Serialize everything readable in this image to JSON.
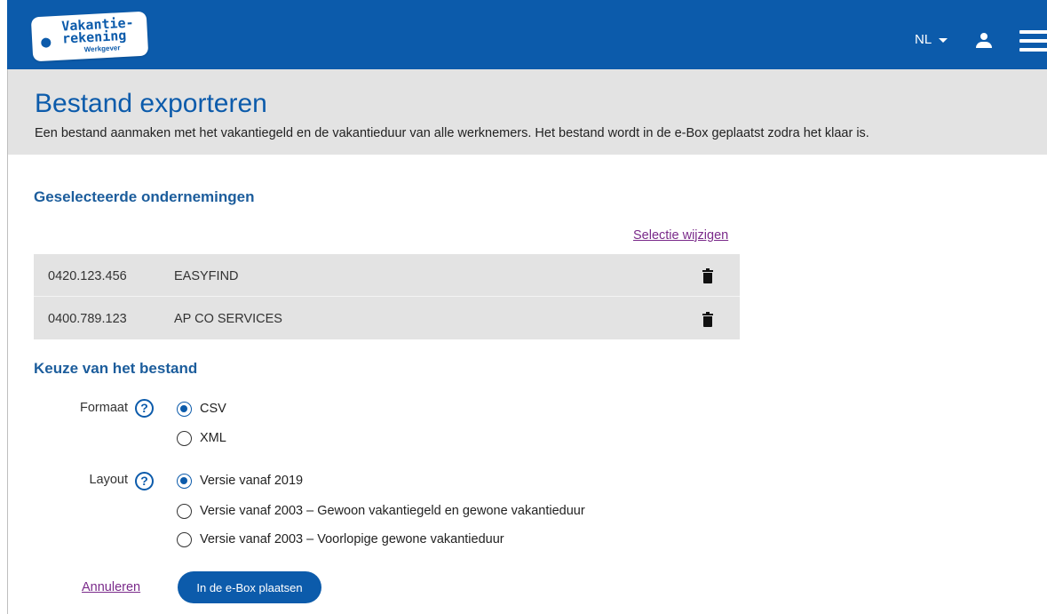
{
  "header": {
    "logo": {
      "line1": "Vakantie-",
      "line2": "rekening",
      "line3": "Werkgever"
    },
    "language": "NL",
    "icons": [
      "chevron-down-icon",
      "user-icon",
      "hamburger-menu-icon"
    ],
    "brand_color": "#0c5bab"
  },
  "page": {
    "title": "Bestand exporteren",
    "description": "Een bestand aanmaken met het vakantiegeld en de vakantieduur van alle werknemers. Het bestand wordt in de e-Box geplaatst zodra het klaar is."
  },
  "companies": {
    "heading": "Geselecteerde ondernemingen",
    "change_link": "Selectie wijzigen",
    "rows": [
      {
        "number": "0420.123.456",
        "name": "EASYFIND"
      },
      {
        "number": "0400.789.123",
        "name": "AP CO SERVICES"
      }
    ]
  },
  "file_choice": {
    "heading": "Keuze van het bestand",
    "format": {
      "label": "Formaat",
      "help": "?",
      "options": [
        {
          "label": "CSV",
          "selected": true
        },
        {
          "label": "XML",
          "selected": false
        }
      ]
    },
    "layout": {
      "label": "Layout",
      "help": "?",
      "options": [
        {
          "label": "Versie vanaf 2019",
          "selected": true
        },
        {
          "label": "Versie vanaf 2003 – Gewoon vakantiegeld en gewone vakantieduur",
          "selected": false
        },
        {
          "label": "Versie vanaf 2003 – Voorlopige gewone vakantieduur",
          "selected": false
        }
      ]
    }
  },
  "actions": {
    "cancel": "Annuleren",
    "submit": "In de e-Box plaatsen"
  }
}
